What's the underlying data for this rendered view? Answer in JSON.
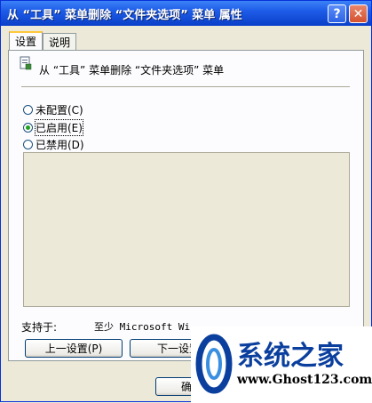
{
  "window": {
    "title": "从 “工具” 菜单删除 “文件夹选项” 菜单 属性",
    "help_icon_glyph": "?",
    "close_icon_glyph": "✕"
  },
  "tabs": [
    {
      "label": "设置",
      "active": true
    },
    {
      "label": "说明",
      "active": false
    }
  ],
  "policy": {
    "title": "从 “工具” 菜单删除 “文件夹选项” 菜单"
  },
  "options": [
    {
      "label": "未配置(C)",
      "checked": false
    },
    {
      "label": "已启用(E)",
      "checked": true
    },
    {
      "label": "已禁用(D)",
      "checked": false
    }
  ],
  "support": {
    "label": "支持于:",
    "value": "至少 Microsoft Wi..."
  },
  "buttons": {
    "prev": "上一设置(P)",
    "next": "下一设置",
    "ok": "确"
  },
  "watermark": {
    "name": "系统之家",
    "url": "www.Ghost123.com"
  },
  "colors": {
    "title_bar": "#1E5CE8",
    "face": "#ECE9D8",
    "tab_highlight": "#FFC83C"
  }
}
